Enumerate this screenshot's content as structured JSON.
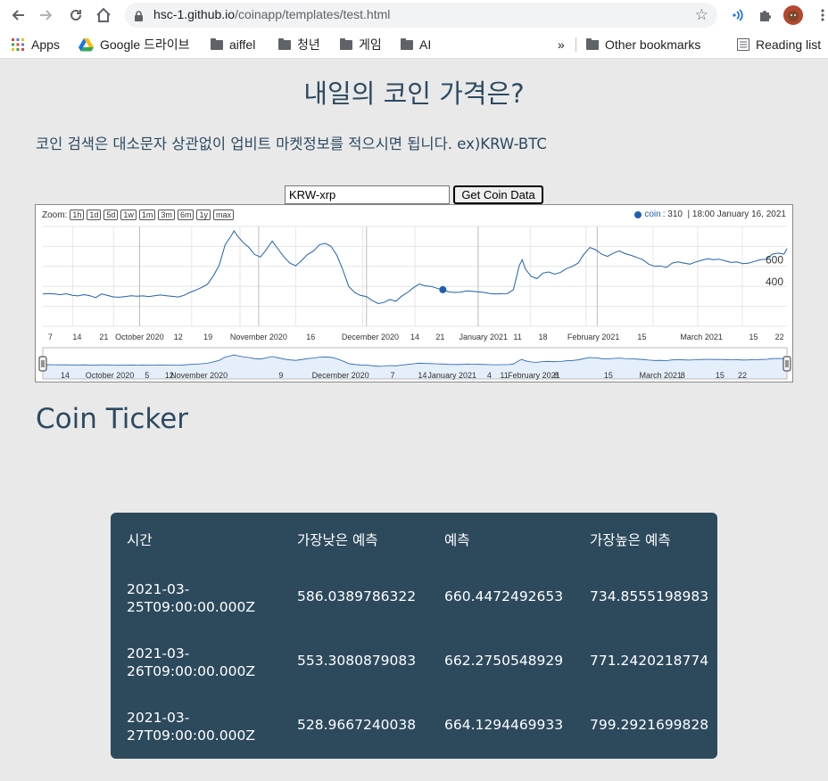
{
  "browser": {
    "url_host": "hsc-1.github.io",
    "url_path": "/coinapp/templates/test.html",
    "bookmarks": [
      {
        "label": "Apps",
        "icon": "apps-grid-icon"
      },
      {
        "label": "Google 드라이브",
        "icon": "google-drive-icon"
      },
      {
        "label": "aiffel",
        "icon": "folder-icon"
      },
      {
        "label": "청년",
        "icon": "folder-icon"
      },
      {
        "label": "게임",
        "icon": "folder-icon"
      },
      {
        "label": "AI",
        "icon": "folder-icon"
      }
    ],
    "overflow": "»",
    "other_bookmarks": "Other bookmarks",
    "reading_list": "Reading list"
  },
  "page": {
    "title": "내일의 코인 가격은?",
    "description": "코인 검색은 대소문자 상관없이 업비트 마켓정보를 적으시면 됩니다. ex)KRW-BTC",
    "search_value": "KRW-xrp",
    "search_button": "Get Coin Data",
    "ticker_title": "Coin Ticker"
  },
  "chart_data": {
    "type": "line",
    "zoom_label": "Zoom:",
    "zoom_buttons": [
      "1h",
      "1d",
      "5d",
      "1w",
      "1m",
      "3m",
      "6m",
      "1y",
      "max"
    ],
    "series": [
      {
        "name": "coin",
        "color": "#1f5fb0"
      }
    ],
    "legend_value": "310",
    "legend_time": "18:00 January 16, 2021",
    "y_ticks": [
      "600",
      "400"
    ],
    "ylim": [
      0,
      900
    ],
    "x_ticks": [
      "7",
      "14",
      "21",
      "October 2020",
      "12",
      "19",
      "November 2020",
      "16",
      "December 2020",
      "14",
      "21",
      "January 2021",
      "11",
      "18",
      "February 2021",
      "15",
      "March 2021",
      "15",
      "22"
    ],
    "nav_ticks": [
      "14",
      "October 2020",
      "5",
      "12",
      "November 2020",
      "9",
      "December 2020",
      "7",
      "14",
      "January 2021",
      "4",
      "11",
      "February 2021",
      "8",
      "15",
      "March 2021",
      "8",
      "15",
      "22"
    ],
    "points": [
      [
        0,
        292
      ],
      [
        4,
        296
      ],
      [
        8,
        292
      ],
      [
        12,
        285
      ],
      [
        16,
        293
      ],
      [
        20,
        280
      ],
      [
        24,
        274
      ],
      [
        28,
        285
      ],
      [
        32,
        276
      ],
      [
        36,
        259
      ],
      [
        40,
        292
      ],
      [
        44,
        278
      ],
      [
        48,
        265
      ],
      [
        52,
        262
      ],
      [
        56,
        268
      ],
      [
        60,
        276
      ],
      [
        64,
        272
      ],
      [
        68,
        274
      ],
      [
        72,
        268
      ],
      [
        76,
        275
      ],
      [
        80,
        282
      ],
      [
        84,
        276
      ],
      [
        88,
        270
      ],
      [
        92,
        264
      ],
      [
        96,
        279
      ],
      [
        100,
        305
      ],
      [
        104,
        326
      ],
      [
        108,
        350
      ],
      [
        112,
        380
      ],
      [
        116,
        456
      ],
      [
        120,
        553
      ],
      [
        124,
        736
      ],
      [
        128,
        815
      ],
      [
        130,
        860
      ],
      [
        132,
        820
      ],
      [
        136,
        758
      ],
      [
        140,
        712
      ],
      [
        144,
        648
      ],
      [
        148,
        624
      ],
      [
        152,
        692
      ],
      [
        156,
        768
      ],
      [
        160,
        695
      ],
      [
        164,
        625
      ],
      [
        168,
        570
      ],
      [
        172,
        545
      ],
      [
        176,
        594
      ],
      [
        180,
        648
      ],
      [
        184,
        678
      ],
      [
        188,
        734
      ],
      [
        192,
        748
      ],
      [
        196,
        720
      ],
      [
        200,
        640
      ],
      [
        204,
        510
      ],
      [
        208,
        360
      ],
      [
        212,
        305
      ],
      [
        216,
        278
      ],
      [
        220,
        268
      ],
      [
        224,
        232
      ],
      [
        228,
        205
      ],
      [
        232,
        215
      ],
      [
        236,
        242
      ],
      [
        240,
        226
      ],
      [
        244,
        272
      ],
      [
        248,
        305
      ],
      [
        252,
        348
      ],
      [
        256,
        382
      ],
      [
        260,
        365
      ],
      [
        264,
        360
      ],
      [
        268,
        343
      ],
      [
        272,
        330
      ],
      [
        276,
        310
      ],
      [
        280,
        305
      ],
      [
        284,
        308
      ],
      [
        288,
        320
      ],
      [
        292,
        316
      ],
      [
        296,
        310
      ],
      [
        300,
        305
      ],
      [
        304,
        296
      ],
      [
        308,
        292
      ],
      [
        312,
        294
      ],
      [
        316,
        296
      ],
      [
        320,
        330
      ],
      [
        324,
        548
      ],
      [
        326,
        600
      ],
      [
        328,
        520
      ],
      [
        332,
        450
      ],
      [
        336,
        430
      ],
      [
        340,
        480
      ],
      [
        344,
        490
      ],
      [
        348,
        470
      ],
      [
        352,
        485
      ],
      [
        356,
        520
      ],
      [
        360,
        540
      ],
      [
        364,
        570
      ],
      [
        368,
        650
      ],
      [
        372,
        710
      ],
      [
        376,
        690
      ],
      [
        380,
        650
      ],
      [
        384,
        630
      ],
      [
        388,
        660
      ],
      [
        392,
        680
      ],
      [
        396,
        655
      ],
      [
        400,
        640
      ],
      [
        404,
        620
      ],
      [
        408,
        600
      ],
      [
        412,
        560
      ],
      [
        416,
        540
      ],
      [
        420,
        545
      ],
      [
        424,
        530
      ],
      [
        428,
        570
      ],
      [
        432,
        580
      ],
      [
        436,
        570
      ],
      [
        440,
        560
      ],
      [
        444,
        580
      ],
      [
        448,
        595
      ],
      [
        452,
        610
      ],
      [
        456,
        600
      ],
      [
        460,
        605
      ],
      [
        464,
        590
      ],
      [
        468,
        575
      ],
      [
        472,
        580
      ],
      [
        476,
        565
      ],
      [
        480,
        570
      ],
      [
        484,
        585
      ],
      [
        488,
        600
      ],
      [
        492,
        605
      ],
      [
        496,
        650
      ],
      [
        500,
        660
      ],
      [
        504,
        650
      ],
      [
        506,
        700
      ]
    ],
    "highlight_index": 69
  },
  "table": {
    "headers": [
      "시간",
      "가장낮은 예측",
      "예측",
      "가장높은 예측"
    ],
    "rows": [
      {
        "time": "2021-03-25T09:00:00.000Z",
        "low": "586.0389786322",
        "pred": "660.4472492653",
        "high": "734.8555198983"
      },
      {
        "time": "2021-03-26T09:00:00.000Z",
        "low": "553.3080879083",
        "pred": "662.2750548929",
        "high": "771.2420218774"
      },
      {
        "time": "2021-03-27T09:00:00.000Z",
        "low": "528.9667240038",
        "pred": "664.1294469933",
        "high": "799.2921699828"
      }
    ]
  }
}
